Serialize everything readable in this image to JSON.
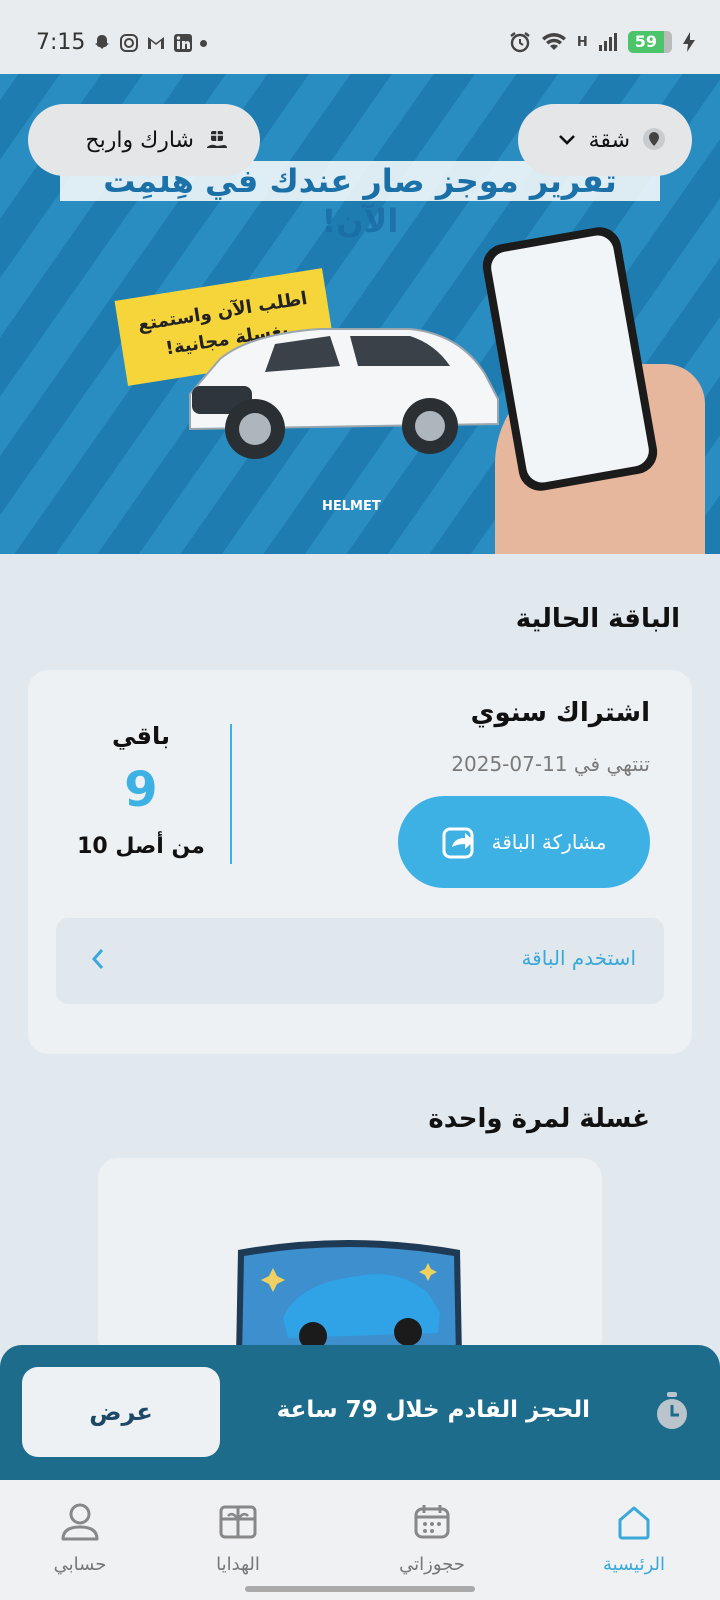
{
  "status_bar": {
    "time": "7:15",
    "network_label": "H",
    "battery": "59"
  },
  "banner": {
    "headline": "تقرير موجز صار عندك في هِلمِت الآن!",
    "sticker_line1": "اطلب الآن واستمتع",
    "sticker_line2": "بغسلة مجانية!",
    "logo_text": "HELMET"
  },
  "header": {
    "share_earn_label": "شارك واربح",
    "property_type_label": "شقة"
  },
  "current_plan": {
    "section_title": "الباقة الحالية",
    "name": "اشتراك سنوي",
    "expiry": "تنتهي في 11-07-2025",
    "share_button": "مشاركة الباقة",
    "remaining_label": "باقي",
    "remaining_value": "9",
    "remaining_total": "من أصل 10",
    "use_plan_label": "استخدم الباقة"
  },
  "one_time_wash": {
    "section_title": "غسلة لمرة واحدة"
  },
  "booking_bar": {
    "message": "الحجز القادم خلال 79 ساعة",
    "view_button": "عرض"
  },
  "bottom_nav": {
    "items": [
      {
        "label": "الرئيسية",
        "icon": "home-icon",
        "active": true
      },
      {
        "label": "حجوزاتي",
        "icon": "calendar-icon",
        "active": false
      },
      {
        "label": "الهدايا",
        "icon": "gift-icon",
        "active": false
      },
      {
        "label": "حسابي",
        "icon": "user-icon",
        "active": false
      }
    ]
  },
  "colors": {
    "accent": "#3db1e3",
    "booking_bar": "#1d6c8c",
    "background": "#e1e8ee"
  }
}
